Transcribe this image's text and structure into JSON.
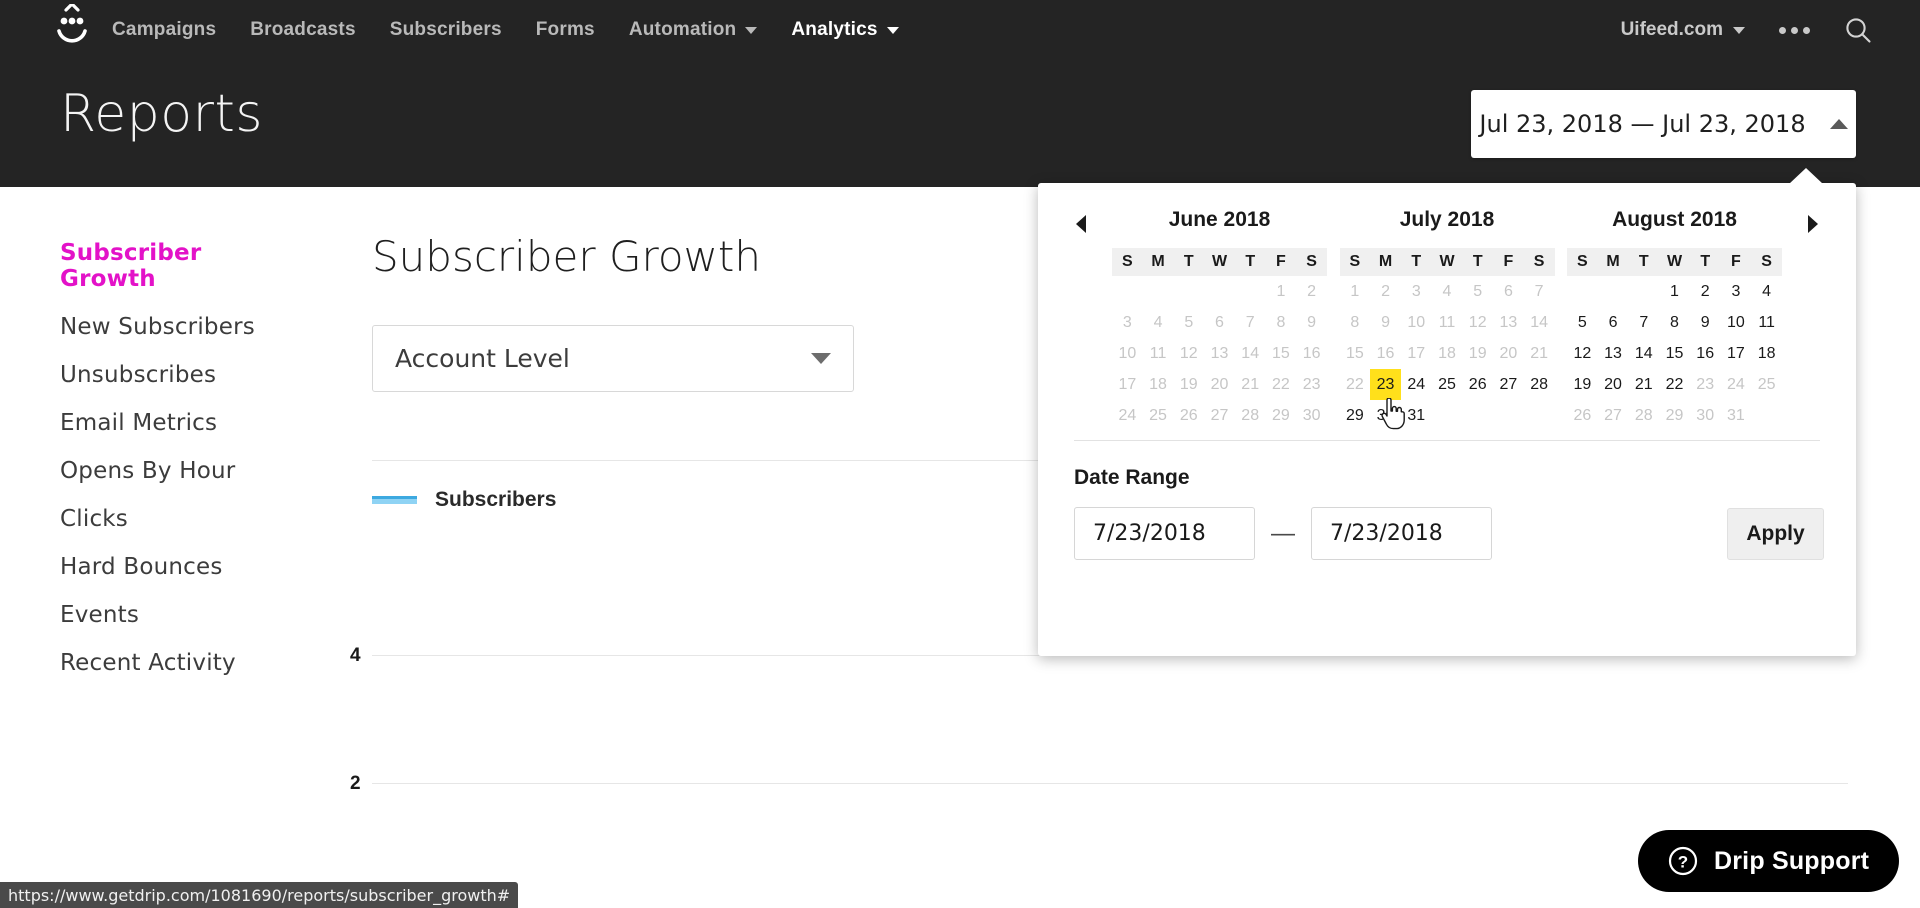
{
  "nav": {
    "logo_icon": "drip-smiley-logo",
    "links": [
      {
        "label": "Campaigns",
        "has_caret": false,
        "active": false
      },
      {
        "label": "Broadcasts",
        "has_caret": false,
        "active": false
      },
      {
        "label": "Subscribers",
        "has_caret": false,
        "active": false
      },
      {
        "label": "Forms",
        "has_caret": false,
        "active": false
      },
      {
        "label": "Automation",
        "has_caret": true,
        "active": false
      },
      {
        "label": "Analytics",
        "has_caret": true,
        "active": true
      }
    ],
    "account": "Uifeed.com",
    "overflow_icon": "more-dots-icon",
    "search_icon": "search-icon"
  },
  "header": {
    "title": "Reports",
    "date_range_button": "Jul 23, 2018 — Jul 23, 2018",
    "date_range_caret_icon": "chevron-up-icon"
  },
  "calendar": {
    "prev_icon": "prev-month-arrow-icon",
    "next_icon": "next-month-arrow-icon",
    "dow": [
      "S",
      "M",
      "T",
      "W",
      "T",
      "F",
      "S"
    ],
    "highlight_color": "#ffe01b",
    "cursor_icon": "pointer-hand-cursor",
    "months": [
      {
        "title": "June 2018",
        "lead_blanks": 5,
        "days": [
          {
            "n": 1,
            "state": "muted"
          },
          {
            "n": 2,
            "state": "muted"
          },
          {
            "n": 3,
            "state": "muted"
          },
          {
            "n": 4,
            "state": "muted"
          },
          {
            "n": 5,
            "state": "muted"
          },
          {
            "n": 6,
            "state": "muted"
          },
          {
            "n": 7,
            "state": "muted"
          },
          {
            "n": 8,
            "state": "muted"
          },
          {
            "n": 9,
            "state": "muted"
          },
          {
            "n": 10,
            "state": "muted"
          },
          {
            "n": 11,
            "state": "muted"
          },
          {
            "n": 12,
            "state": "muted"
          },
          {
            "n": 13,
            "state": "muted"
          },
          {
            "n": 14,
            "state": "muted"
          },
          {
            "n": 15,
            "state": "muted"
          },
          {
            "n": 16,
            "state": "muted"
          },
          {
            "n": 17,
            "state": "muted"
          },
          {
            "n": 18,
            "state": "muted"
          },
          {
            "n": 19,
            "state": "muted"
          },
          {
            "n": 20,
            "state": "muted"
          },
          {
            "n": 21,
            "state": "muted"
          },
          {
            "n": 22,
            "state": "muted"
          },
          {
            "n": 23,
            "state": "muted"
          },
          {
            "n": 24,
            "state": "muted"
          },
          {
            "n": 25,
            "state": "muted"
          },
          {
            "n": 26,
            "state": "muted"
          },
          {
            "n": 27,
            "state": "muted"
          },
          {
            "n": 28,
            "state": "muted"
          },
          {
            "n": 29,
            "state": "muted"
          },
          {
            "n": 30,
            "state": "muted"
          }
        ]
      },
      {
        "title": "July 2018",
        "lead_blanks": 0,
        "days": [
          {
            "n": 1,
            "state": "muted"
          },
          {
            "n": 2,
            "state": "muted"
          },
          {
            "n": 3,
            "state": "muted"
          },
          {
            "n": 4,
            "state": "muted"
          },
          {
            "n": 5,
            "state": "muted"
          },
          {
            "n": 6,
            "state": "muted"
          },
          {
            "n": 7,
            "state": "muted"
          },
          {
            "n": 8,
            "state": "muted"
          },
          {
            "n": 9,
            "state": "muted"
          },
          {
            "n": 10,
            "state": "muted"
          },
          {
            "n": 11,
            "state": "muted"
          },
          {
            "n": 12,
            "state": "muted"
          },
          {
            "n": 13,
            "state": "muted"
          },
          {
            "n": 14,
            "state": "muted"
          },
          {
            "n": 15,
            "state": "muted"
          },
          {
            "n": 16,
            "state": "muted"
          },
          {
            "n": 17,
            "state": "muted"
          },
          {
            "n": 18,
            "state": "muted"
          },
          {
            "n": 19,
            "state": "muted"
          },
          {
            "n": 20,
            "state": "muted"
          },
          {
            "n": 21,
            "state": "muted"
          },
          {
            "n": 22,
            "state": "muted"
          },
          {
            "n": 23,
            "state": "selected"
          },
          {
            "n": 24,
            "state": "active"
          },
          {
            "n": 25,
            "state": "active"
          },
          {
            "n": 26,
            "state": "active"
          },
          {
            "n": 27,
            "state": "active"
          },
          {
            "n": 28,
            "state": "active"
          },
          {
            "n": 29,
            "state": "active"
          },
          {
            "n": 30,
            "state": "active"
          },
          {
            "n": 31,
            "state": "active"
          }
        ]
      },
      {
        "title": "August 2018",
        "lead_blanks": 3,
        "days": [
          {
            "n": 1,
            "state": "active"
          },
          {
            "n": 2,
            "state": "active"
          },
          {
            "n": 3,
            "state": "active"
          },
          {
            "n": 4,
            "state": "active"
          },
          {
            "n": 5,
            "state": "active"
          },
          {
            "n": 6,
            "state": "active"
          },
          {
            "n": 7,
            "state": "active"
          },
          {
            "n": 8,
            "state": "active"
          },
          {
            "n": 9,
            "state": "active"
          },
          {
            "n": 10,
            "state": "active"
          },
          {
            "n": 11,
            "state": "active"
          },
          {
            "n": 12,
            "state": "active"
          },
          {
            "n": 13,
            "state": "active"
          },
          {
            "n": 14,
            "state": "active"
          },
          {
            "n": 15,
            "state": "active"
          },
          {
            "n": 16,
            "state": "active"
          },
          {
            "n": 17,
            "state": "active"
          },
          {
            "n": 18,
            "state": "active"
          },
          {
            "n": 19,
            "state": "active"
          },
          {
            "n": 20,
            "state": "active"
          },
          {
            "n": 21,
            "state": "active"
          },
          {
            "n": 22,
            "state": "active"
          },
          {
            "n": 23,
            "state": "muted"
          },
          {
            "n": 24,
            "state": "muted"
          },
          {
            "n": 25,
            "state": "muted"
          },
          {
            "n": 26,
            "state": "muted"
          },
          {
            "n": 27,
            "state": "muted"
          },
          {
            "n": 28,
            "state": "muted"
          },
          {
            "n": 29,
            "state": "muted"
          },
          {
            "n": 30,
            "state": "muted"
          },
          {
            "n": 31,
            "state": "muted"
          }
        ]
      }
    ],
    "date_range": {
      "label": "Date Range",
      "start_value": "7/23/2018",
      "end_value": "7/23/2018",
      "separator": "—",
      "apply_label": "Apply"
    }
  },
  "sidebar": {
    "items": [
      {
        "label": "Subscriber Growth",
        "active": true
      },
      {
        "label": "New Subscribers",
        "active": false
      },
      {
        "label": "Unsubscribes",
        "active": false
      },
      {
        "label": "Email Metrics",
        "active": false
      },
      {
        "label": "Opens By Hour",
        "active": false
      },
      {
        "label": "Clicks",
        "active": false
      },
      {
        "label": "Hard Bounces",
        "active": false
      },
      {
        "label": "Events",
        "active": false
      },
      {
        "label": "Recent Activity",
        "active": false
      }
    ],
    "active_color": "#e312c8"
  },
  "main": {
    "title": "Subscriber Growth",
    "level_select_value": "Account Level",
    "level_select_caret_icon": "chevron-down-icon"
  },
  "chart_data": {
    "type": "line",
    "title": "Subscriber Growth",
    "series": [
      {
        "name": "Subscribers",
        "color": "#8fd3f4",
        "values": []
      }
    ],
    "legend": [
      "Subscribers"
    ],
    "legend_position": "top-left",
    "categories": [],
    "x": [],
    "xlabel": "",
    "ylabel": "",
    "yticks": [
      4,
      2
    ],
    "ylim": [
      0,
      5
    ],
    "grid": true
  },
  "support": {
    "label": "Drip Support",
    "icon": "question-circle-icon"
  },
  "statusbar": {
    "url": "https://www.getdrip.com/1081690/reports/subscriber_growth#"
  }
}
